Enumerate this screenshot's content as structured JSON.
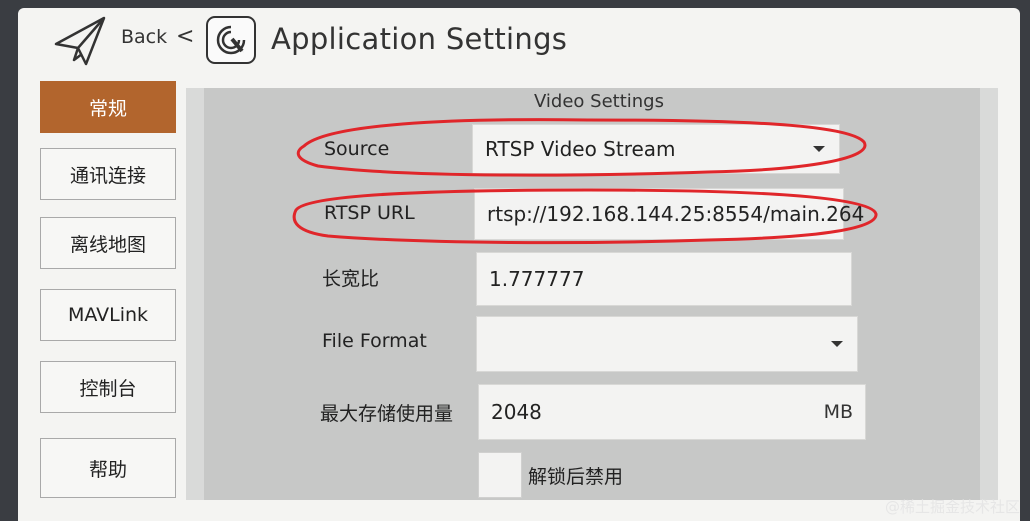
{
  "header": {
    "back_label": "Back",
    "back_chevron": "<",
    "title": "Application Settings",
    "icons": {
      "back": "paper-plane-icon",
      "logo": "qgc-logo"
    }
  },
  "sidebar": {
    "items": [
      {
        "label": "常规",
        "active": true
      },
      {
        "label": "通讯连接",
        "active": false
      },
      {
        "label": "离线地图",
        "active": false
      },
      {
        "label": "MAVLink",
        "active": false
      },
      {
        "label": "控制台",
        "active": false
      },
      {
        "label": "帮助",
        "active": false
      }
    ]
  },
  "video_settings": {
    "title": "Video Settings",
    "source": {
      "label": "Source",
      "value": "RTSP Video Stream"
    },
    "rtsp_url": {
      "label": "RTSP URL",
      "value": "rtsp://192.168.144.25:8554/main.264"
    },
    "aspect_ratio": {
      "label": "长宽比",
      "value": "1.777777"
    },
    "file_format": {
      "label": "File Format",
      "value": ""
    },
    "max_storage": {
      "label": "最大存储使用量",
      "value": "2048",
      "unit": "MB"
    },
    "disable_when_armed": {
      "label": "解锁后禁用",
      "checked": false
    }
  },
  "watermark": "@稀土掘金技术社区",
  "colors": {
    "accent": "#b2652d",
    "annotation": "#e0262a"
  }
}
